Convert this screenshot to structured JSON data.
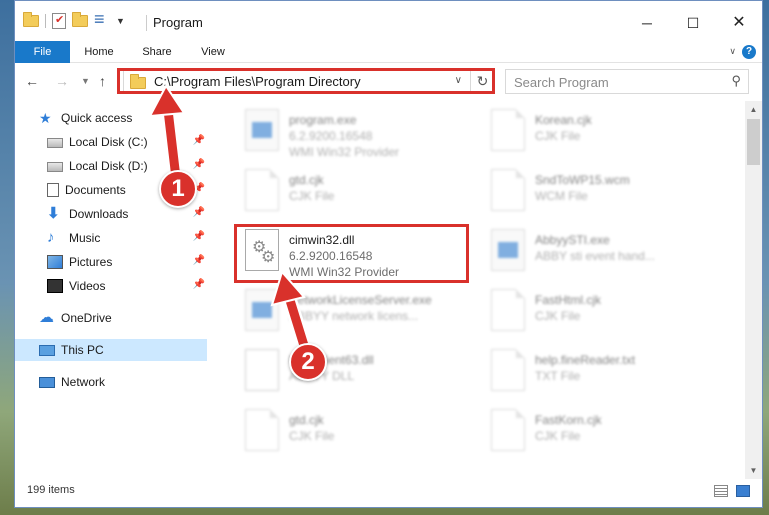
{
  "window": {
    "title": "Program",
    "controls": {
      "minimize": "─",
      "maximize": "☐",
      "close": "✕"
    }
  },
  "ribbon": {
    "tabs": [
      "File",
      "Home",
      "Share",
      "View"
    ],
    "help": "?"
  },
  "address": {
    "path": "C:\\Program Files\\Program Directory",
    "search_placeholder": "Search Program"
  },
  "sidebar": {
    "items": [
      {
        "label": "Quick access",
        "icon": "star-icon"
      },
      {
        "label": "Local Disk (C:)",
        "icon": "drive-icon",
        "pinned": true
      },
      {
        "label": "Local Disk (D:)",
        "icon": "drive-icon",
        "pinned": true
      },
      {
        "label": "Documents",
        "icon": "documents-icon",
        "pinned": true
      },
      {
        "label": "Downloads",
        "icon": "download-icon",
        "pinned": true
      },
      {
        "label": "Music",
        "icon": "music-icon",
        "pinned": true
      },
      {
        "label": "Pictures",
        "icon": "pictures-icon",
        "pinned": true
      },
      {
        "label": "Videos",
        "icon": "videos-icon",
        "pinned": true
      },
      {
        "label": "OneDrive",
        "icon": "cloud-icon"
      },
      {
        "label": "This PC",
        "icon": "computer-icon",
        "selected": true
      },
      {
        "label": "Network",
        "icon": "network-icon"
      }
    ]
  },
  "files": {
    "left": [
      {
        "name": "program.exe",
        "line1": "6.2.9200.16548",
        "line2": "WMI Win32 Provider",
        "type": "exe"
      },
      {
        "name": "gtd.cjk",
        "line1": "CJK File",
        "line2": "",
        "type": "page"
      },
      {
        "name": "cimwin32.dll",
        "line1": "6.2.9200.16548",
        "line2": "WMI Win32 Provider",
        "type": "dll",
        "highlighted": true
      },
      {
        "name": "NetworkLicenseServer.exe",
        "line1": "ABBYY network licens...",
        "line2": "",
        "type": "exe"
      },
      {
        "name": "UserClient63.dll",
        "line1": "ABBYY DLL",
        "line2": "",
        "type": "dll"
      },
      {
        "name": "gtd.cjk",
        "line1": "CJK File",
        "line2": "",
        "type": "page"
      }
    ],
    "right": [
      {
        "name": "Korean.cjk",
        "line1": "CJK File",
        "line2": "",
        "type": "page"
      },
      {
        "name": "SndToWP15.wcm",
        "line1": "WCM File",
        "line2": "",
        "type": "page"
      },
      {
        "name": "AbbyySTI.exe",
        "line1": "ABBY sti event hand...",
        "line2": "",
        "type": "exe"
      },
      {
        "name": "FastHtml.cjk",
        "line1": "CJK File",
        "line2": "",
        "type": "page"
      },
      {
        "name": "help.fineReader.txt",
        "line1": "TXT File",
        "line2": "",
        "type": "page"
      },
      {
        "name": "FastKorn.cjk",
        "line1": "CJK File",
        "line2": "",
        "type": "page"
      }
    ]
  },
  "status": {
    "count": "199 items"
  },
  "annotations": {
    "badge1": "1",
    "badge2": "2",
    "color": "#d9312b"
  }
}
